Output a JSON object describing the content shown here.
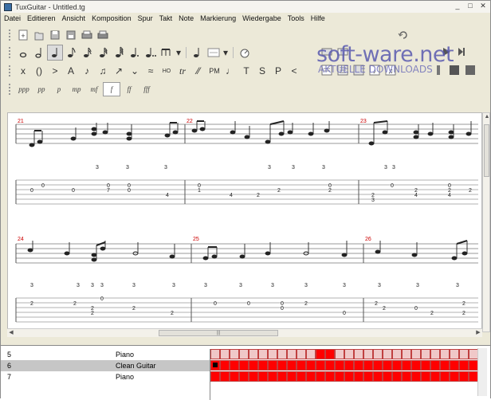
{
  "window": {
    "title": "TuxGuitar - Untitled.tg",
    "minimize": "_",
    "maximize": "□",
    "close": "✕"
  },
  "menu": [
    "Datei",
    "Editieren",
    "Ansicht",
    "Komposition",
    "Spur",
    "Takt",
    "Note",
    "Markierung",
    "Wiedergabe",
    "Tools",
    "Hilfe"
  ],
  "watermark": {
    "main": "soft-ware.net",
    "sub": "AKTUELLE DOWNLOADS"
  },
  "dynamics": [
    "ppp",
    "pp",
    "p",
    "mp",
    "mf",
    "f",
    "ff",
    "fff"
  ],
  "dynamics_selected": "f",
  "effects": [
    "x",
    "()",
    ">",
    "A",
    "♪",
    "♫",
    "↗",
    "⌄",
    "≈",
    "HO",
    "tr",
    "⁄⁄",
    "PM",
    "♩",
    "T",
    "S",
    "P",
    "<"
  ],
  "score": {
    "row1_measures": [
      "21",
      "22",
      "23"
    ],
    "row2_measures": [
      "24",
      "25",
      "26"
    ],
    "accent_color": "#cc0000"
  },
  "tracks": [
    {
      "number": "5",
      "name": "Piano",
      "selected": false
    },
    {
      "number": "6",
      "name": "Clean Guitar",
      "selected": true
    },
    {
      "number": "7",
      "name": "Piano",
      "selected": false
    }
  ],
  "colors": {
    "track_fill": "#ff0000",
    "track_empty": "#f0c8c8"
  }
}
